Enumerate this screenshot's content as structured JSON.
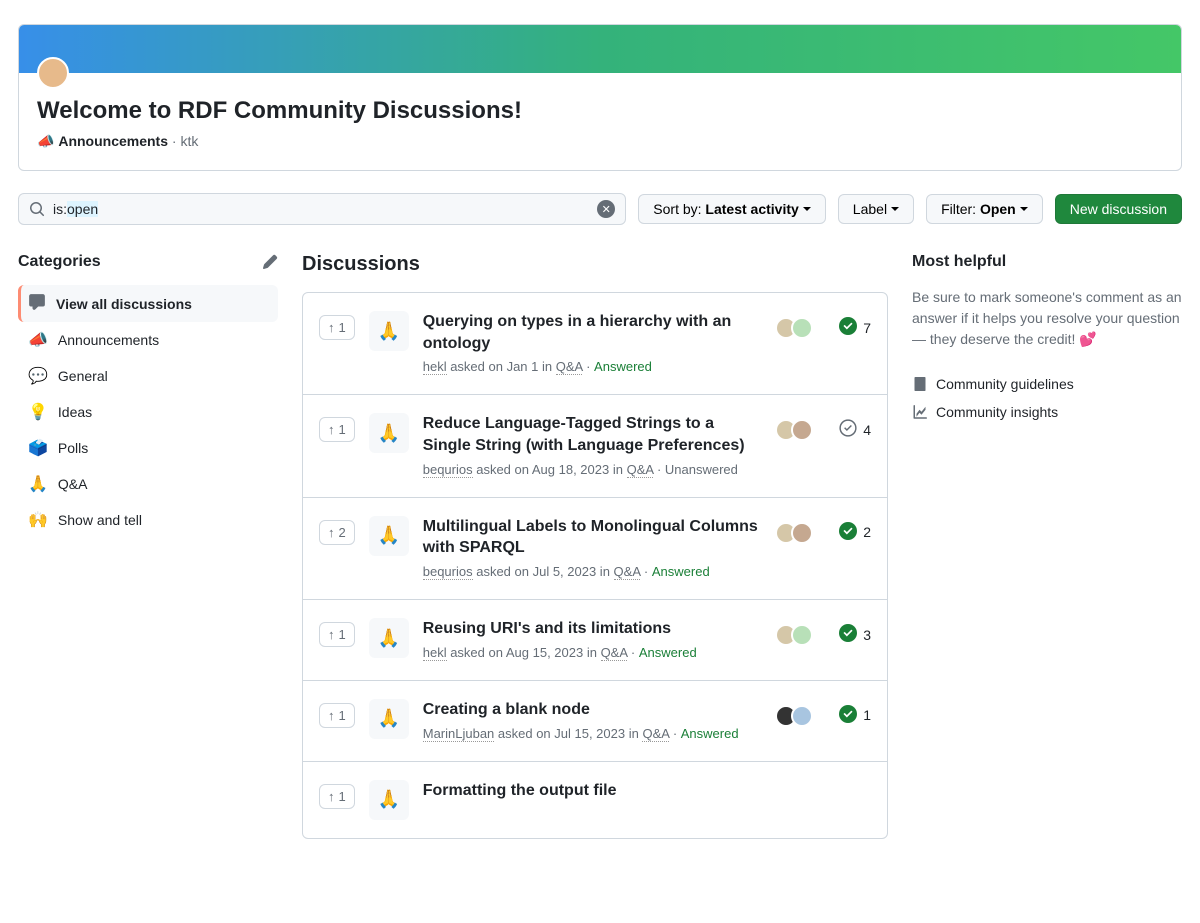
{
  "banner": {
    "title": "Welcome to RDF Community Discussions!",
    "category_emoji": "📣",
    "category": "Announcements",
    "author": "ktk"
  },
  "search": {
    "prefix": "is:",
    "query": "open"
  },
  "toolbar": {
    "sort_prefix": "Sort by:",
    "sort_value": "Latest activity",
    "label": "Label",
    "filter_prefix": "Filter:",
    "filter_value": "Open",
    "new_discussion": "New discussion"
  },
  "categories_heading": "Categories",
  "categories": [
    {
      "emoji": "💬",
      "label": "View all discussions",
      "icon": "comment",
      "active": true
    },
    {
      "emoji": "📣",
      "label": "Announcements"
    },
    {
      "emoji": "💬",
      "label": "General"
    },
    {
      "emoji": "💡",
      "label": "Ideas"
    },
    {
      "emoji": "🗳️",
      "label": "Polls"
    },
    {
      "emoji": "🙏",
      "label": "Q&A"
    },
    {
      "emoji": "🙌",
      "label": "Show and tell"
    }
  ],
  "discussions_heading": "Discussions",
  "discussions": [
    {
      "upvotes": "1",
      "emoji": "🙏",
      "title": "Querying on types in a hierarchy with an ontology",
      "author": "hekl",
      "asked": "asked on Jan 1 in",
      "cat": "Q&A",
      "status": "Answered",
      "answered": true,
      "comments": "7",
      "avatars": [
        "#d5c7a8",
        "#b8e0b8"
      ]
    },
    {
      "upvotes": "1",
      "emoji": "🙏",
      "title": "Reduce Language-Tagged Strings to a Single String (with Language Preferences)",
      "author": "bequrios",
      "asked": "asked on Aug 18, 2023 in",
      "cat": "Q&A",
      "status": "Unanswered",
      "answered": false,
      "comments": "4",
      "avatars": [
        "#d5c7a8",
        "#c5a890"
      ]
    },
    {
      "upvotes": "2",
      "emoji": "🙏",
      "title": "Multilingual Labels to Monolingual Columns with SPARQL",
      "author": "bequrios",
      "asked": "asked on Jul 5, 2023 in",
      "cat": "Q&A",
      "status": "Answered",
      "answered": true,
      "comments": "2",
      "avatars": [
        "#d5c7a8",
        "#c5a890"
      ]
    },
    {
      "upvotes": "1",
      "emoji": "🙏",
      "title": "Reusing URI's and its limitations",
      "author": "hekl",
      "asked": "asked on Aug 15, 2023 in",
      "cat": "Q&A",
      "status": "Answered",
      "answered": true,
      "comments": "3",
      "avatars": [
        "#d5c7a8",
        "#b8e0b8"
      ]
    },
    {
      "upvotes": "1",
      "emoji": "🙏",
      "title": "Creating a blank node",
      "author": "MarinLjuban",
      "asked": "asked on Jul 15, 2023 in",
      "cat": "Q&A",
      "status": "Answered",
      "answered": true,
      "comments": "1",
      "avatars": [
        "#333",
        "#a8c5e0"
      ]
    },
    {
      "upvotes": "1",
      "emoji": "🙏",
      "title": "Formatting the output file",
      "author": "",
      "asked": "",
      "cat": "",
      "status": "",
      "answered": true,
      "comments": "",
      "avatars": []
    }
  ],
  "sidebar": {
    "heading": "Most helpful",
    "text": "Be sure to mark someone's comment as an answer if it helps you resolve your question — they deserve the credit! 💕",
    "links": [
      {
        "label": "Community guidelines",
        "icon": "checklist"
      },
      {
        "label": "Community insights",
        "icon": "graph"
      }
    ]
  }
}
